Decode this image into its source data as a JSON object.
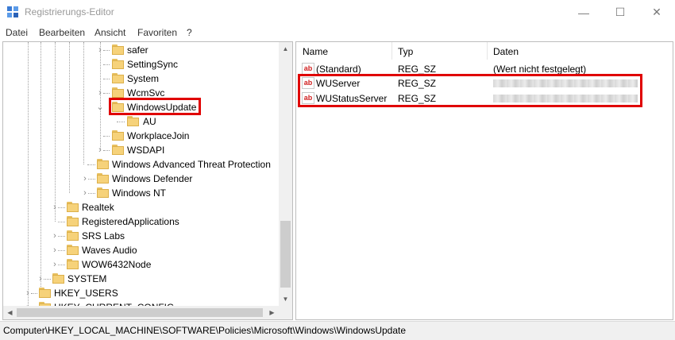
{
  "window": {
    "title": "Registrierungs-Editor"
  },
  "controls": {
    "minimize": "—",
    "maximize": "☐",
    "close": "✕"
  },
  "menu": [
    "Datei",
    "Bearbeiten",
    "Ansicht",
    "Favoriten",
    "?"
  ],
  "tree": [
    {
      "label": "safer",
      "expander": "›"
    },
    {
      "label": "SettingSync",
      "expander": ""
    },
    {
      "label": "System",
      "expander": ""
    },
    {
      "label": "WcmSvc",
      "expander": "›"
    },
    {
      "label": "WindowsUpdate",
      "expander": "⌄",
      "selected": true
    },
    {
      "label": "AU",
      "expander": ""
    },
    {
      "label": "WorkplaceJoin",
      "expander": ""
    },
    {
      "label": "WSDAPI",
      "expander": "›"
    },
    {
      "label": "Windows Advanced Threat Protection",
      "expander": ""
    },
    {
      "label": "Windows Defender",
      "expander": "›"
    },
    {
      "label": "Windows NT",
      "expander": "›"
    },
    {
      "label": "Realtek",
      "expander": "›"
    },
    {
      "label": "RegisteredApplications",
      "expander": ""
    },
    {
      "label": "SRS Labs",
      "expander": "›"
    },
    {
      "label": "Waves Audio",
      "expander": "›"
    },
    {
      "label": "WOW6432Node",
      "expander": "›"
    },
    {
      "label": "SYSTEM",
      "expander": "›"
    },
    {
      "label": "HKEY_USERS",
      "expander": "›"
    },
    {
      "label": "HKEY_CURRENT_CONFIG",
      "expander": "›"
    }
  ],
  "columns": {
    "name": "Name",
    "type": "Typ",
    "data": "Daten"
  },
  "values": [
    {
      "name": "(Standard)",
      "type": "REG_SZ",
      "data": "(Wert nicht festgelegt)",
      "redacted": false
    },
    {
      "name": "WUServer",
      "type": "REG_SZ",
      "data": "",
      "redacted": true
    },
    {
      "name": "WUStatusServer",
      "type": "REG_SZ",
      "data": "",
      "redacted": true
    }
  ],
  "status": {
    "path": "Computer\\HKEY_LOCAL_MACHINE\\SOFTWARE\\Policies\\Microsoft\\Windows\\WindowsUpdate"
  },
  "colors": {
    "highlight": "#e00000",
    "folder": "#f6d27a",
    "reg_icon_text": "#d02020"
  }
}
